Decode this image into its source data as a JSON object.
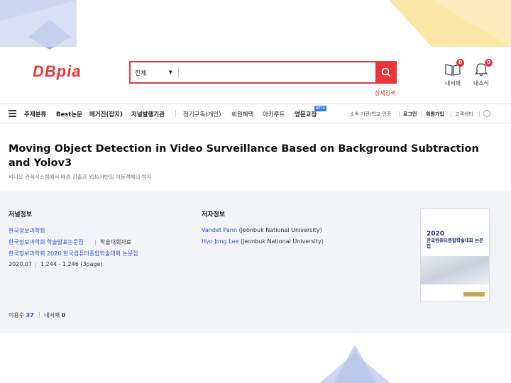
{
  "header": {
    "logo_text": "DBpia",
    "search": {
      "scope_label": "전체",
      "value": "",
      "placeholder": ""
    },
    "advanced_search_label": "상세검색",
    "icons": [
      {
        "name": "my-library",
        "label": "내서재",
        "badge": "0"
      },
      {
        "name": "my-news",
        "label": "내소식",
        "badge": "0"
      }
    ]
  },
  "nav": {
    "items": [
      "주제분류",
      "Best논문",
      "메거진(잡지)",
      "저널발행기관",
      "정기구독(개인)",
      "회원혜택",
      "아카루트",
      "영문교정"
    ],
    "beta_label": "BETA",
    "utility": [
      "소속 기관/학교 인증",
      "로그인",
      "회원가입",
      "고객센터"
    ]
  },
  "article": {
    "title": "Moving Object Detection in Video Surveillance Based on Background Subtraction and Yolov3",
    "subtitle": "비디오 관제시스템에서 배경 감출과 Yolo기반의 이동객체의 탐지"
  },
  "journal_info": {
    "heading": "저널정보",
    "publisher": "한국정보과학회",
    "series": "한국정보과학회 학술발표논문집",
    "series_type": "학술대회자료",
    "proceedings": "한국정보과학회 2020 한국컴퓨터종합학술대회 논문집",
    "date": "2020.07",
    "pages": "1,244 - 1,246 (3page)"
  },
  "author_info": {
    "heading": "저자정보",
    "authors": [
      {
        "name": "Vandet Pann",
        "affiliation": "(Jeonbuk National University)"
      },
      {
        "name": "Hyo Jong Lee",
        "affiliation": "(Jeonbuk National University)"
      }
    ]
  },
  "stats": {
    "usage_label": "이용수",
    "usage_value": "37",
    "library_label": "내서재",
    "library_value": "0"
  },
  "cover": {
    "year": "2020",
    "name": "한국컴퓨터종합학술대회 논문집"
  },
  "colors": {
    "brand": "#e8363b",
    "link": "#2b51c7",
    "panel_bg": "#f2f4f8",
    "deco_yellow": "#fbe7a6",
    "deco_blue": "#b7c6ea"
  }
}
